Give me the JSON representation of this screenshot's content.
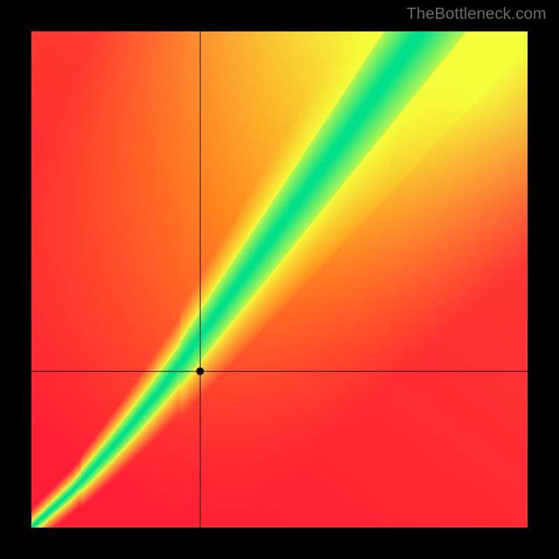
{
  "watermark": "TheBottleneck.com",
  "chart_data": {
    "type": "heatmap",
    "title": "",
    "xlabel": "",
    "ylabel": "",
    "xlim": [
      0,
      1
    ],
    "ylim": [
      0,
      1
    ],
    "marker": {
      "x": 0.34,
      "y": 0.315
    },
    "crosshair": {
      "x": 0.34,
      "y": 0.315
    },
    "green_band_description": "Diagonal optimal band from lower-left origin curving upward, steepening after x≈0.3, representing balanced pairing; red = bottleneck, green = optimal.",
    "colors": {
      "optimal": "#00e28b",
      "near": "#e6ff2f",
      "warm": "#ff9a1f",
      "bottleneck": "#ff1f36"
    }
  }
}
